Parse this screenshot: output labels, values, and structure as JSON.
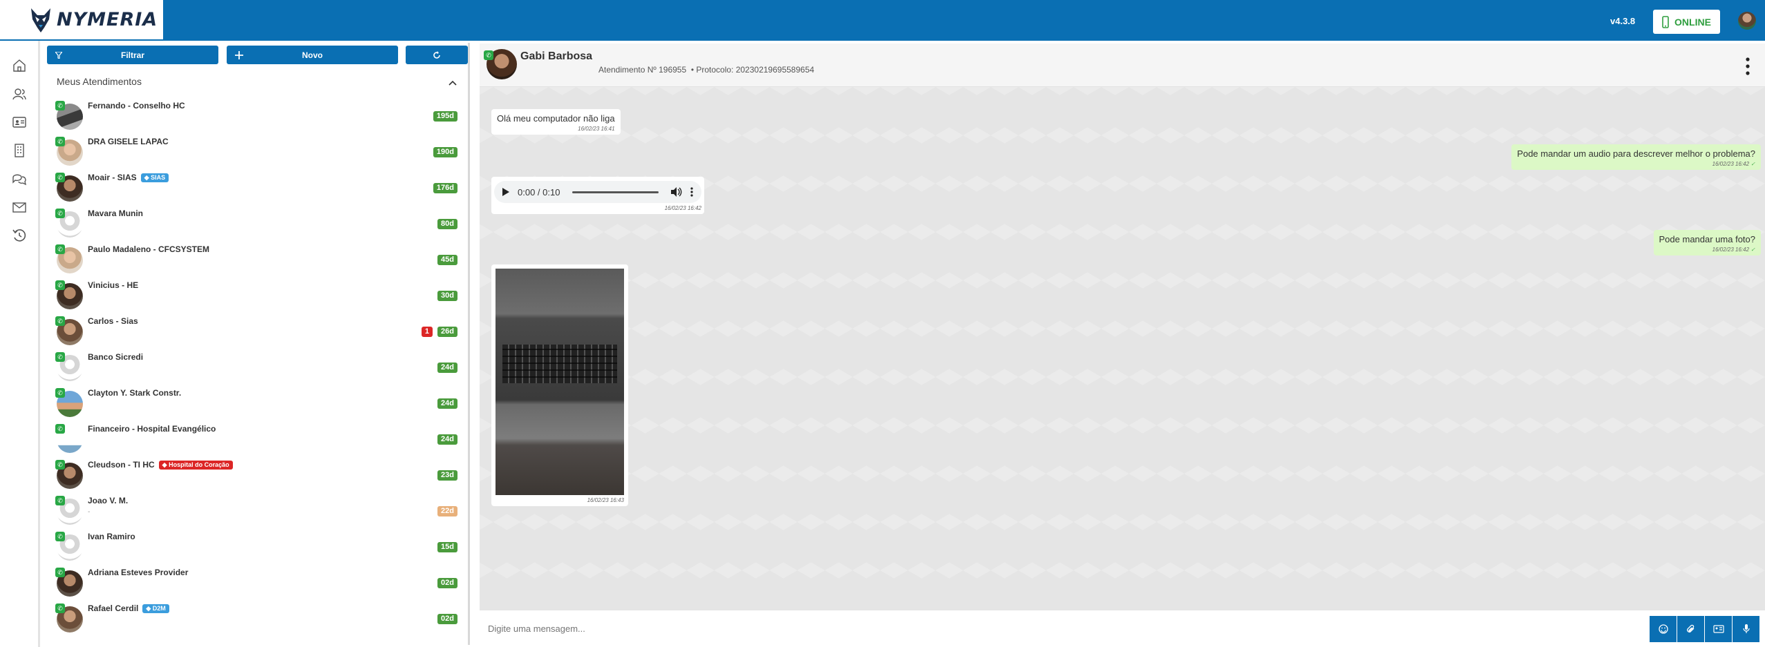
{
  "app": {
    "logo_text": "NYMERIA",
    "version": "v4.3.8",
    "status_label": "ONLINE",
    "brand_color": "#0a6fb3",
    "online_color": "#2e9e3e"
  },
  "toolbar": {
    "filter_label": "Filtrar",
    "new_label": "Novo"
  },
  "section": {
    "title": "Meus Atendimentos"
  },
  "conversations": [
    {
      "name": "Fernando - Conselho HC",
      "age": "195d",
      "tag": "",
      "tag_color": "",
      "unread": "",
      "avatar": "laptop"
    },
    {
      "name": "DRA GISELE LAPAC",
      "age": "190d",
      "tag": "",
      "tag_color": "",
      "unread": "",
      "avatar": "person-light"
    },
    {
      "name": "Moair - SIAS",
      "age": "176d",
      "tag": "SIAS",
      "tag_color": "#3b9ddd",
      "unread": "",
      "avatar": "person-dark"
    },
    {
      "name": "Mavara Munin",
      "age": "80d",
      "tag": "",
      "tag_color": "",
      "unread": "",
      "avatar": "default"
    },
    {
      "name": "Paulo Madaleno - CFCSYSTEM",
      "age": "45d",
      "tag": "",
      "tag_color": "",
      "unread": "",
      "avatar": "person-light"
    },
    {
      "name": "Vinicius - HE",
      "age": "30d",
      "tag": "",
      "tag_color": "",
      "unread": "",
      "avatar": "person-dark"
    },
    {
      "name": "Carlos - Sias",
      "age": "26d",
      "tag": "",
      "tag_color": "",
      "unread": "1",
      "avatar": "person-mid"
    },
    {
      "name": "Banco Sicredi",
      "age": "24d",
      "tag": "",
      "tag_color": "",
      "unread": "",
      "avatar": "default"
    },
    {
      "name": "Clayton Y. Stark Constr.",
      "age": "24d",
      "tag": "",
      "tag_color": "",
      "unread": "",
      "avatar": "outdoor"
    },
    {
      "name": "Financeiro - Hospital Evangélico",
      "age": "24d",
      "tag": "",
      "tag_color": "",
      "unread": "",
      "avatar": "logo"
    },
    {
      "name": "Cleudson - TI HC",
      "age": "23d",
      "tag": "Hospital do Coração",
      "tag_color": "#dc2626",
      "unread": "",
      "avatar": "person-dark"
    },
    {
      "name": "Joao V. M.",
      "age": "22d",
      "tag": "",
      "tag_color": "",
      "unread": "",
      "avatar": "default",
      "sub": "-",
      "age_color": "#e8b07a"
    },
    {
      "name": "Ivan Ramiro",
      "age": "15d",
      "tag": "",
      "tag_color": "",
      "unread": "",
      "avatar": "default"
    },
    {
      "name": "Adriana Esteves Provider",
      "age": "02d",
      "tag": "",
      "tag_color": "",
      "unread": "",
      "avatar": "person-dark"
    },
    {
      "name": "Rafael Cerdil",
      "age": "02d",
      "tag": "D2M",
      "tag_color": "#3b9ddd",
      "unread": "",
      "avatar": "person-mid"
    }
  ],
  "chat": {
    "contact_name": "Gabi Barbosa",
    "attendance": "Atendimento Nº 196955",
    "protocol": "• Protocolo: 20230219695589654",
    "messages": [
      {
        "dir": "in",
        "type": "text",
        "text": "Olá meu computador não liga",
        "time": "16/02/23 16:41"
      },
      {
        "dir": "out",
        "type": "text",
        "text": "Pode mandar um audio para descrever melhor o problema?",
        "time": "16/02/23 16:42"
      },
      {
        "dir": "in",
        "type": "audio",
        "audio_time": "0:00 / 0:10",
        "time": "16/02/23 16:42"
      },
      {
        "dir": "out",
        "type": "text",
        "text": "Pode mandar uma foto?",
        "time": "16/02/23 16:42"
      },
      {
        "dir": "in",
        "type": "image",
        "time": "16/02/23 16:43"
      }
    ],
    "composer_placeholder": "Digite uma mensagem..."
  }
}
